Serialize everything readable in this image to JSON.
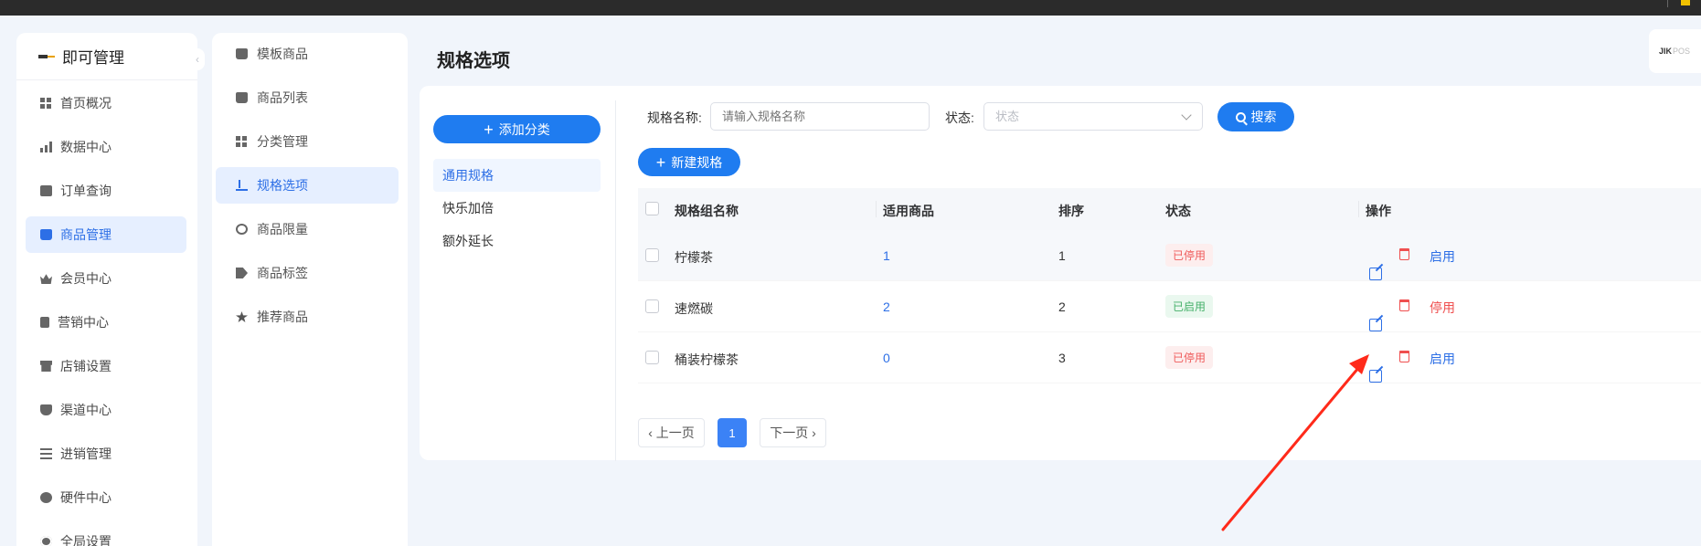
{
  "brand": {
    "title": "即可管理"
  },
  "corner_logo": {
    "text": "JIK",
    "suffix": "POS"
  },
  "sidebar": {
    "items": [
      {
        "label": "首页概况",
        "icon": "grid-icon"
      },
      {
        "label": "数据中心",
        "icon": "bar-chart-icon"
      },
      {
        "label": "订单查询",
        "icon": "box-icon"
      },
      {
        "label": "商品管理",
        "icon": "bag-icon",
        "active": true
      },
      {
        "label": "会员中心",
        "icon": "crown-icon"
      },
      {
        "label": "营销中心",
        "icon": "phone-icon"
      },
      {
        "label": "店铺设置",
        "icon": "store-icon"
      },
      {
        "label": "渠道中心",
        "icon": "shield-icon"
      },
      {
        "label": "进销管理",
        "icon": "list-icon"
      },
      {
        "label": "硬件中心",
        "icon": "disk-icon"
      },
      {
        "label": "全局设置",
        "icon": "gear-icon"
      }
    ]
  },
  "subnav": {
    "items": [
      {
        "label": "模板商品",
        "icon": "bag-icon"
      },
      {
        "label": "商品列表",
        "icon": "bag-icon"
      },
      {
        "label": "分类管理",
        "icon": "grid-icon"
      },
      {
        "label": "规格选项",
        "icon": "upload-icon",
        "active": true
      },
      {
        "label": "商品限量",
        "icon": "clock-icon"
      },
      {
        "label": "商品标签",
        "icon": "tag-icon"
      },
      {
        "label": "推荐商品",
        "icon": "star-icon"
      }
    ]
  },
  "page": {
    "title": "规格选项"
  },
  "categories": {
    "add_label": "添加分类",
    "items": [
      "通用规格",
      "快乐加倍",
      "额外延长"
    ]
  },
  "filters": {
    "name_label": "规格名称:",
    "name_placeholder": "请输入规格名称",
    "status_label": "状态:",
    "status_placeholder": "状态",
    "search_label": "搜索"
  },
  "toolbar": {
    "new_spec_label": "新建规格"
  },
  "table": {
    "columns": [
      "规格组名称",
      "适用商品",
      "排序",
      "状态",
      "操作"
    ],
    "rows": [
      {
        "name": "柠檬茶",
        "count": "1",
        "sort": "1",
        "status": "已停用",
        "status_type": "off",
        "toggle": "启用"
      },
      {
        "name": "速燃碳",
        "count": "2",
        "sort": "2",
        "status": "已启用",
        "status_type": "on",
        "toggle": "停用"
      },
      {
        "name": "桶装柠檬茶",
        "count": "0",
        "sort": "3",
        "status": "已停用",
        "status_type": "off",
        "toggle": "启用"
      }
    ]
  },
  "pagination": {
    "prev": "上一页",
    "current": "1",
    "next": "下一页"
  },
  "colors": {
    "primary": "#1f7cf0",
    "danger": "#ef4f4f",
    "success": "#45b069",
    "annotation": "#ff2a1a"
  }
}
